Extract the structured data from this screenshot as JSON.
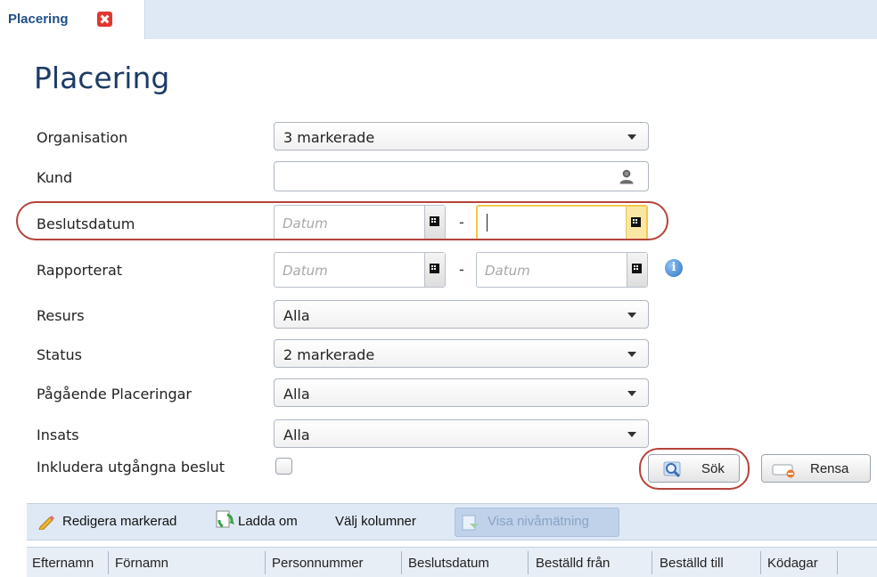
{
  "tab": {
    "label": "Placering"
  },
  "page": {
    "title": "Placering"
  },
  "form": {
    "organisation": {
      "label": "Organisation",
      "value": "3 markerade"
    },
    "kund": {
      "label": "Kund",
      "value": ""
    },
    "beslutsdatum": {
      "label": "Beslutsdatum",
      "from_placeholder": "Datum",
      "separator": "-",
      "to_value": ""
    },
    "rapporterat": {
      "label": "Rapporterat",
      "from_placeholder": "Datum",
      "separator": "-",
      "to_placeholder": "Datum"
    },
    "resurs": {
      "label": "Resurs",
      "value": "Alla"
    },
    "status": {
      "label": "Status",
      "value": "2 markerade"
    },
    "pagaende": {
      "label": "Pågående Placeringar",
      "value": "Alla"
    },
    "insats": {
      "label": "Insats",
      "value": "Alla"
    },
    "inkludera": {
      "label": "Inkludera utgångna beslut",
      "checked": false
    }
  },
  "buttons": {
    "search": "Sök",
    "clear": "Rensa"
  },
  "toolbar": {
    "edit": "Redigera markerad",
    "reload": "Ladda om",
    "columns": "Välj kolumner",
    "level": "Visa nivåmätning"
  },
  "columns": [
    "Efternamn",
    "Förnamn",
    "Personnummer",
    "Beslutsdatum",
    "Beställd från",
    "Beställd till",
    "Ködagar"
  ],
  "colors": {
    "title": "#1d3b66",
    "highlight": "#b5433a",
    "focus": "#f2c94c",
    "toolbar_bg": "#dfe9f5"
  }
}
